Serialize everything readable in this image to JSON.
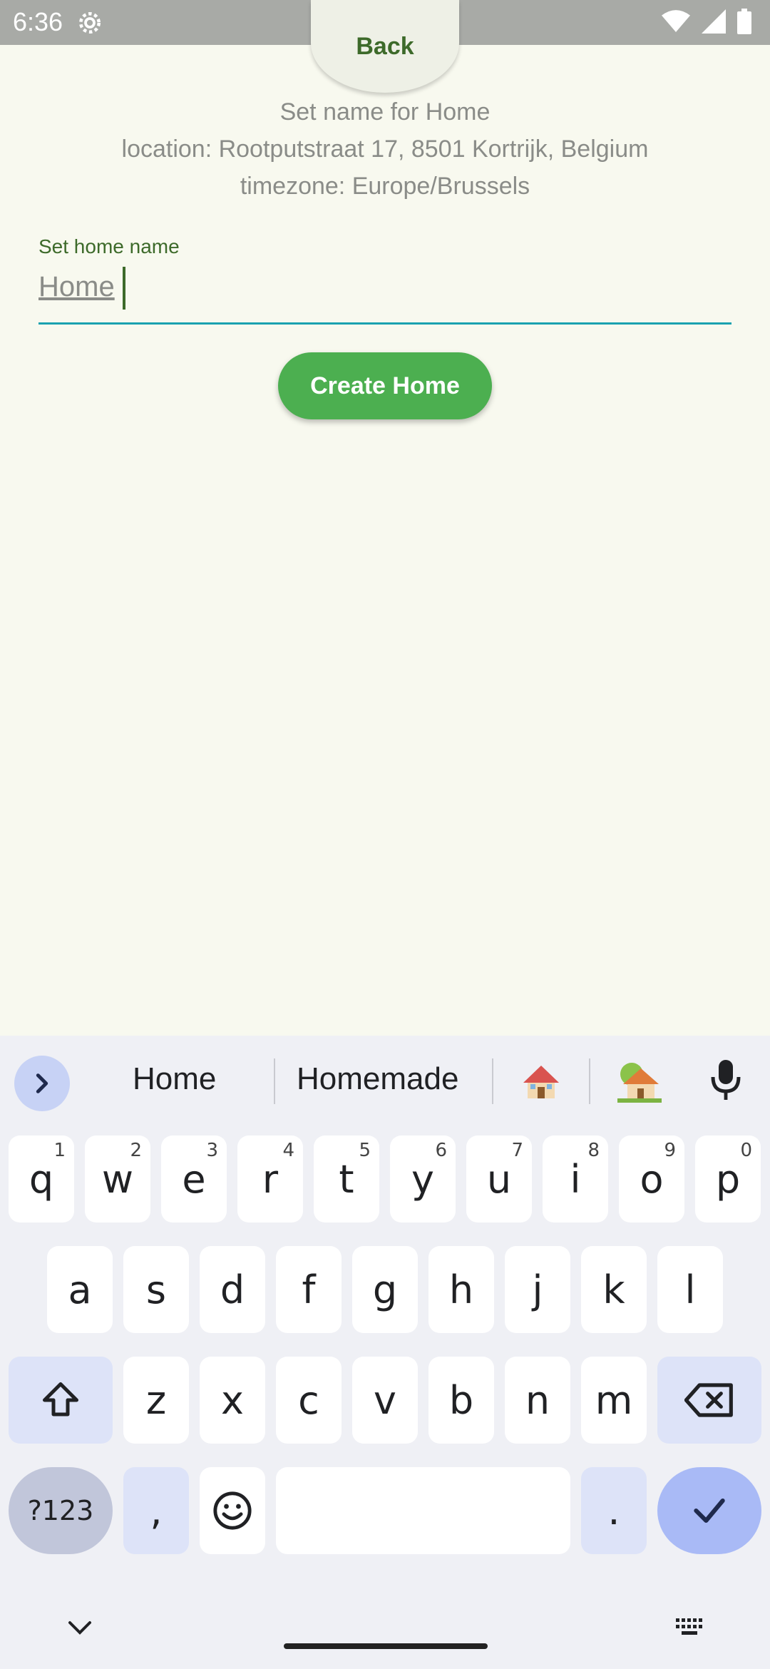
{
  "status_bar": {
    "time": "6:36"
  },
  "header": {
    "back_label": "Back"
  },
  "info": {
    "title": "Set name for Home",
    "location": "location: Rootputstraat 17, 8501 Kortrijk, Belgium",
    "timezone": "timezone: Europe/Brussels"
  },
  "form": {
    "label": "Set home name",
    "value": "Home",
    "create_label": "Create Home"
  },
  "keyboard": {
    "suggestions": [
      "Home",
      "Homemade"
    ],
    "row1": [
      "q",
      "w",
      "e",
      "r",
      "t",
      "y",
      "u",
      "i",
      "o",
      "p"
    ],
    "row1_hints": [
      "1",
      "2",
      "3",
      "4",
      "5",
      "6",
      "7",
      "8",
      "9",
      "0"
    ],
    "row2": [
      "a",
      "s",
      "d",
      "f",
      "g",
      "h",
      "j",
      "k",
      "l"
    ],
    "row3": [
      "z",
      "x",
      "c",
      "v",
      "b",
      "n",
      "m"
    ],
    "num_label": "?123",
    "comma": ",",
    "period": "."
  },
  "colors": {
    "accent": "#4caf50",
    "underline": "#1aa2b0",
    "text_green": "#3d6a2a"
  }
}
